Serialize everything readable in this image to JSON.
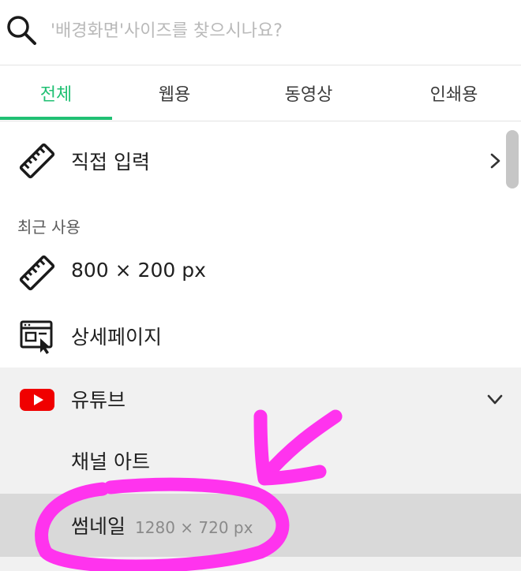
{
  "search": {
    "placeholder": "'배경화면'사이즈를 찾으시나요?"
  },
  "tabs": [
    {
      "label": "전체",
      "active": true
    },
    {
      "label": "웹용",
      "active": false
    },
    {
      "label": "동영상",
      "active": false
    },
    {
      "label": "인쇄용",
      "active": false
    }
  ],
  "list": {
    "custom_input": {
      "label": "직접 입력",
      "icon": "ruler-icon"
    },
    "recent_section_label": "최근 사용",
    "recent": [
      {
        "label": "800 × 200 px",
        "icon": "ruler-icon"
      },
      {
        "label": "상세페이지",
        "icon": "browser-cursor-icon"
      }
    ],
    "youtube": {
      "label": "유튜브",
      "icon": "youtube-icon",
      "expanded": true,
      "children": [
        {
          "label": "채널 아트",
          "size": ""
        },
        {
          "label": "썸네일",
          "size": "1280 × 720 px",
          "selected": true
        }
      ]
    }
  },
  "colors": {
    "accent": "#20c073",
    "youtube_red": "#f00000",
    "annotation": "#ff33ee",
    "selected_bg": "#d9d9d9",
    "expanded_bg": "#f1f1f1"
  }
}
